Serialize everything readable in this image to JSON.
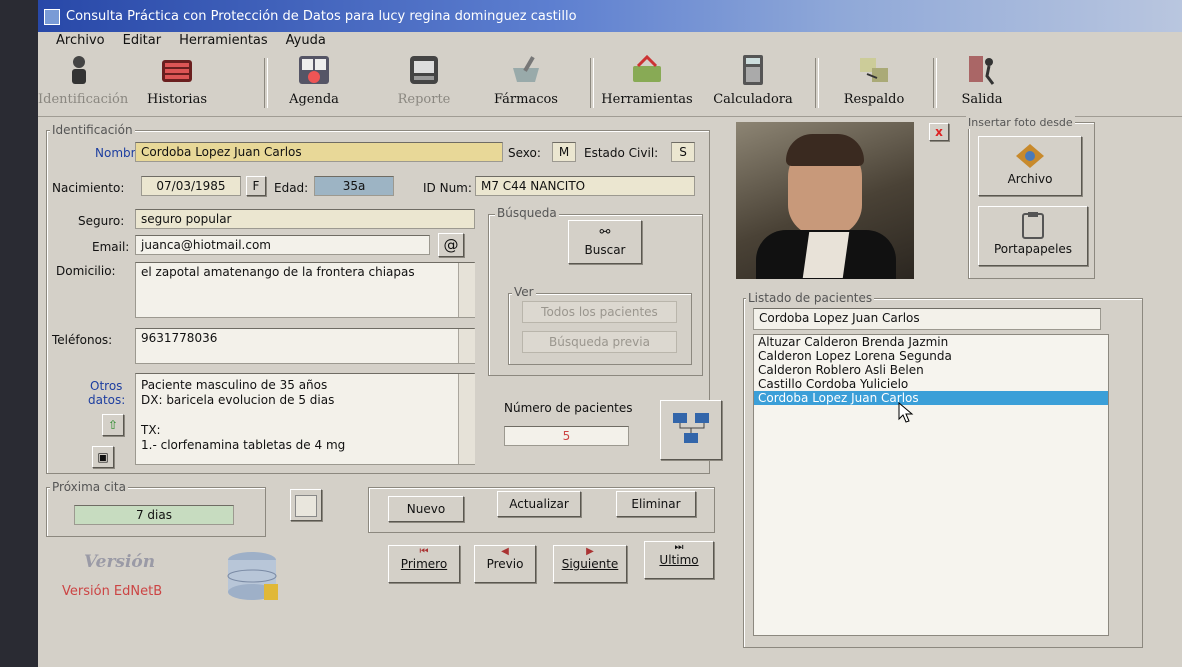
{
  "window": {
    "title": "Consulta Práctica con Protección de Datos para lucy regina dominguez castillo"
  },
  "menu": [
    "Archivo",
    "Editar",
    "Herramientas",
    "Ayuda"
  ],
  "toolbar": [
    {
      "label": "Identificación",
      "icon": "person-icon",
      "enabled": false
    },
    {
      "label": "Historias",
      "icon": "records-icon",
      "enabled": true
    },
    {
      "label": "Agenda",
      "icon": "calendar-icon",
      "enabled": true
    },
    {
      "label": "Reporte",
      "icon": "report-icon",
      "enabled": false
    },
    {
      "label": "Fármacos",
      "icon": "mortar-icon",
      "enabled": true
    },
    {
      "label": "Herramientas",
      "icon": "toolbox-icon",
      "enabled": true
    },
    {
      "label": "Calculadora",
      "icon": "calculator-icon",
      "enabled": true
    },
    {
      "label": "Respaldo",
      "icon": "backup-icon",
      "enabled": true
    },
    {
      "label": "Salida",
      "icon": "exit-icon",
      "enabled": true
    }
  ],
  "ident": {
    "group_label": "Identificación",
    "nombre_label": "Nombre:",
    "nombre": "Cordoba Lopez Juan Carlos",
    "sexo_label": "Sexo:",
    "sexo": "M",
    "estado_label": "Estado Civil:",
    "estado": "S",
    "nacimiento_label": "Nacimiento:",
    "nacimiento": "07/03/1985",
    "f_button": "F",
    "edad_label": "Edad:",
    "edad": "35a",
    "idnum_label": "ID Num:",
    "idnum": "M7 C44 NANCITO",
    "seguro_label": "Seguro:",
    "seguro": "seguro popular",
    "email_label": "Email:",
    "email": "juanca@hiotmail.com",
    "at_button": "@",
    "domicilio_label": "Domicilio:",
    "domicilio": "el zapotal amatenango de la frontera chiapas",
    "telefonos_label": "Teléfonos:",
    "telefonos": "9631778036",
    "otros_label": "Otros",
    "datos_label": "datos:",
    "otros_lines": [
      "Paciente masculino de 35 años",
      "DX: baricela evolucion de 5 dias",
      "",
      "TX:",
      "1.- clorfenamina tabletas de 4 mg"
    ]
  },
  "busqueda": {
    "group_label": "Búsqueda",
    "buscar": "Buscar",
    "ver_label": "Ver",
    "todos": "Todos los pacientes",
    "previa": "Búsqueda previa",
    "num_label": "Número de pacientes",
    "num": "5"
  },
  "foto": {
    "group_label": "Insertar foto desde",
    "archivo": "Archivo",
    "portapapeles": "Portapapeles",
    "close": "x"
  },
  "listado": {
    "group_label": "Listado de pacientes",
    "search": "Cordoba Lopez Juan Carlos",
    "patients": [
      "Altuzar Calderon Brenda Jazmin",
      "Calderon Lopez Lorena Segunda",
      "Calderon Roblero Asli Belen",
      "Castillo Cordoba Yulicielo",
      "Cordoba Lopez Juan Carlos"
    ],
    "selected_index": 4
  },
  "cita": {
    "group_label": "Próxima cita",
    "value": "7 dias"
  },
  "actions": {
    "nuevo": "Nuevo",
    "actualizar": "Actualizar",
    "eliminar": "Eliminar"
  },
  "nav": {
    "primero": "Primero",
    "previo": "Previo",
    "siguiente": "Siguiente",
    "ultimo": "Ultimo"
  },
  "version": {
    "logo": "Versión",
    "text": "Versión EdNetB"
  },
  "colors": {
    "selection": "#3b9fd8",
    "field": "#ebe6d0",
    "accent_red": "#c44444",
    "label_blue": "#1d3ea0"
  }
}
